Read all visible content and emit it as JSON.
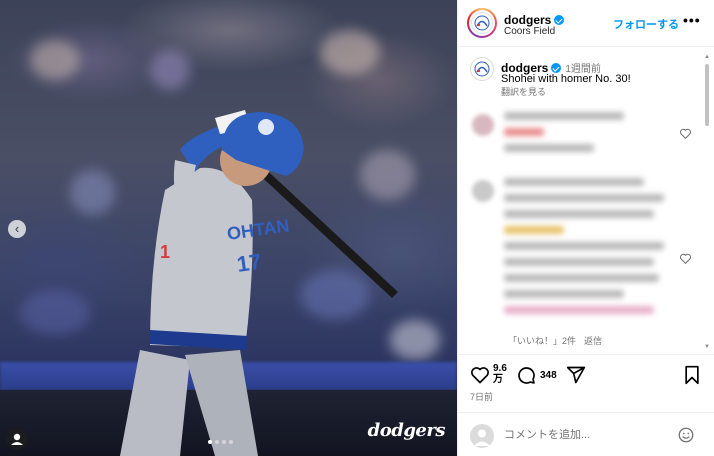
{
  "post": {
    "watermark": "dodgers",
    "carousel_prev": "‹",
    "media_alt": "Shohei Ohtani swinging a bat at Coors Field"
  },
  "header": {
    "username": "dodgers",
    "location": "Coors Field",
    "follow_label": "フォローする",
    "more_label": "•••"
  },
  "caption": {
    "username": "dodgers",
    "time": "1週間前",
    "text": "Shohei with homer No. 30!",
    "translate_label": "翻訳を見る"
  },
  "comments": {
    "reply_likes": "「いいね！」2件",
    "reply_label": "返信"
  },
  "actions": {
    "like_count": "9.6",
    "like_unit": "万",
    "comment_count": "348",
    "post_age": "7日前"
  },
  "composer": {
    "placeholder": "コメントを追加..."
  },
  "colors": {
    "accent": "#0095f6",
    "dodger_blue": "#2f5fbf"
  }
}
